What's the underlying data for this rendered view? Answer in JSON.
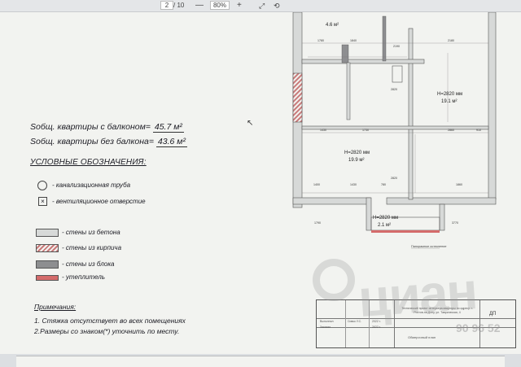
{
  "viewer": {
    "page_current": "2",
    "page_total": "/ 10",
    "zoom": "80%"
  },
  "summary": {
    "with_balcony_label": "Sобщ. квартиры  с балконом=",
    "with_balcony_value": "45.7 м²",
    "without_balcony_label": "Sобщ. квартиры  без балкона=",
    "without_balcony_value": "43.6 м²"
  },
  "legend": {
    "title": "УСЛОВНЫЕ ОБОЗНАЧЕНИЯ:",
    "items": [
      {
        "label": "- канализационная труба"
      },
      {
        "label": "- вентиляционное отверстие"
      },
      {
        "label": "- стены из бетона"
      },
      {
        "label": "- стены из кирпича"
      },
      {
        "label": "- стены из блока"
      },
      {
        "label": "- утеплитель"
      }
    ]
  },
  "notes": {
    "title": "Примечания:",
    "line1": "1. Стяжка отсутствует во всех помещениях",
    "line2": "2.Размеры со знаком(*) уточнить по месту."
  },
  "plan": {
    "room_top_area": "4.6 м²",
    "room_right_height": "H=2820 мм",
    "room_right_area": "19.1 м²",
    "room_center_height": "H=2820 мм",
    "room_center_area": "19.9 м²",
    "room_balcony_height": "H=2820 мм",
    "room_balcony_area": "2.1 м²",
    "panoramic_label": "Панорамное остекление",
    "dims": [
      "1780",
      "1840",
      "2190",
      "2180",
      "1430",
      "1730",
      "2230",
      "910",
      "2860",
      "1530",
      "2820",
      "1430",
      "1860",
      "1400",
      "780",
      "1820",
      "2170",
      "1040",
      "1230",
      "1790",
      "3770"
    ]
  },
  "titleblock": {
    "project_title": "Технический проект интерьера квартиры по адресу: г. Ростов-на-Дону, ул. Таврическая, 4",
    "stage": "ДП",
    "row1": "Выполнил",
    "row1_name": "Сивко У.С.",
    "row2": "Заказал",
    "sheet_name": "Обмерочный план",
    "date1": "2022 г.",
    "date2": "2022 г."
  },
  "watermark": {
    "text": "циан",
    "sub": "90 96 52"
  },
  "colors": {
    "concrete": "#d7d9d8",
    "brick_hatch": "#c97a7a",
    "block": "#8d8e90",
    "insulation": "#d46b6b"
  }
}
